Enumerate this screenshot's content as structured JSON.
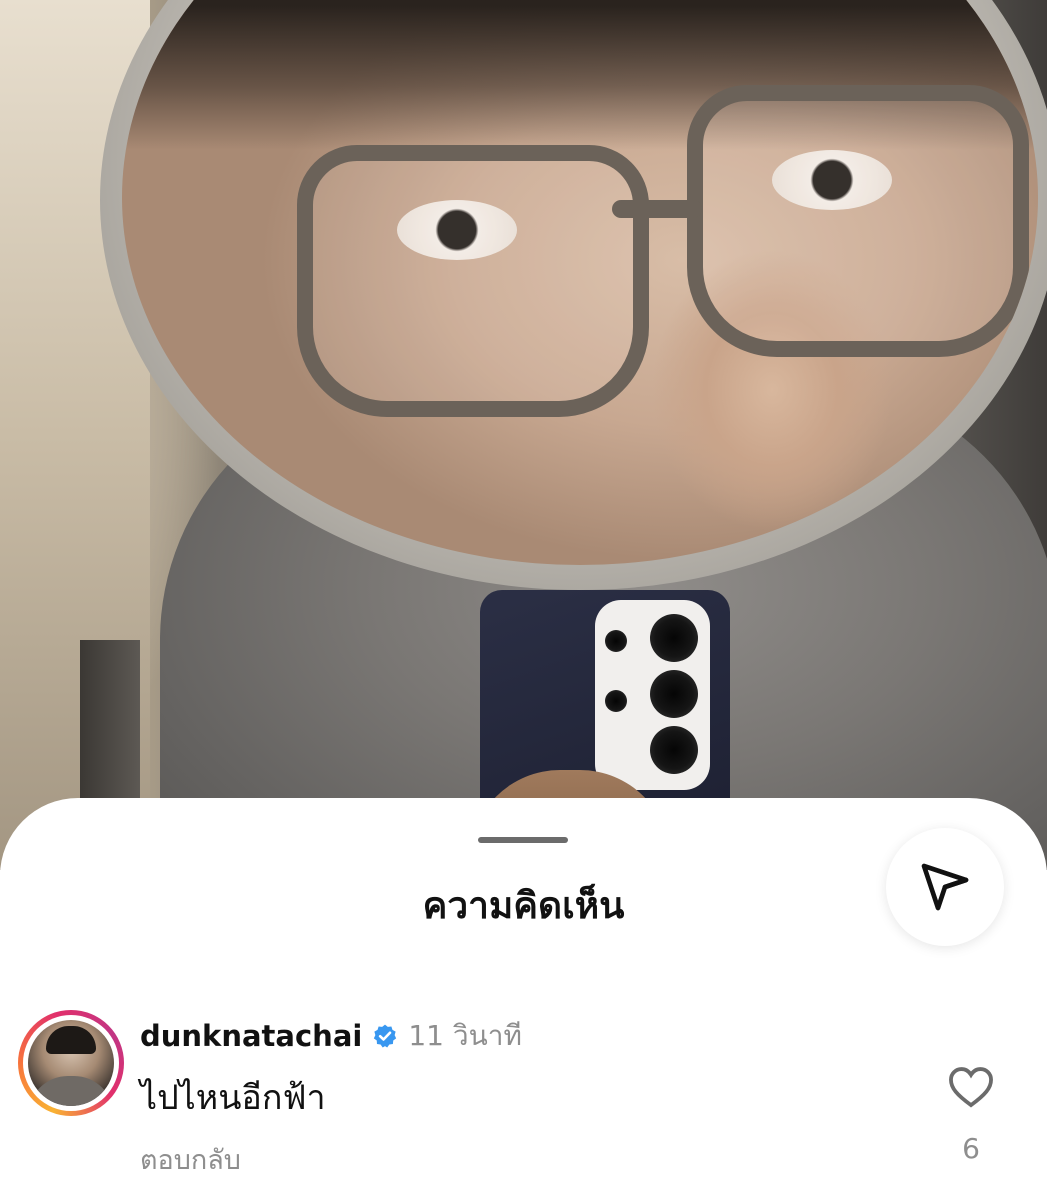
{
  "sheet": {
    "title": "ความคิดเห็น",
    "share_icon": "paper-plane-icon"
  },
  "comment": {
    "username": "dunknatachai",
    "verified_icon": "verified-badge-icon",
    "timestamp": "11 วินาที",
    "text": "ไปไหนอีกฟ้า",
    "reply_label": "ตอบกลับ",
    "like_icon": "heart-icon",
    "like_count": "6"
  },
  "colors": {
    "verified": "#3897f0",
    "secondary_text": "#8e8e8e",
    "primary_text": "#111111"
  }
}
